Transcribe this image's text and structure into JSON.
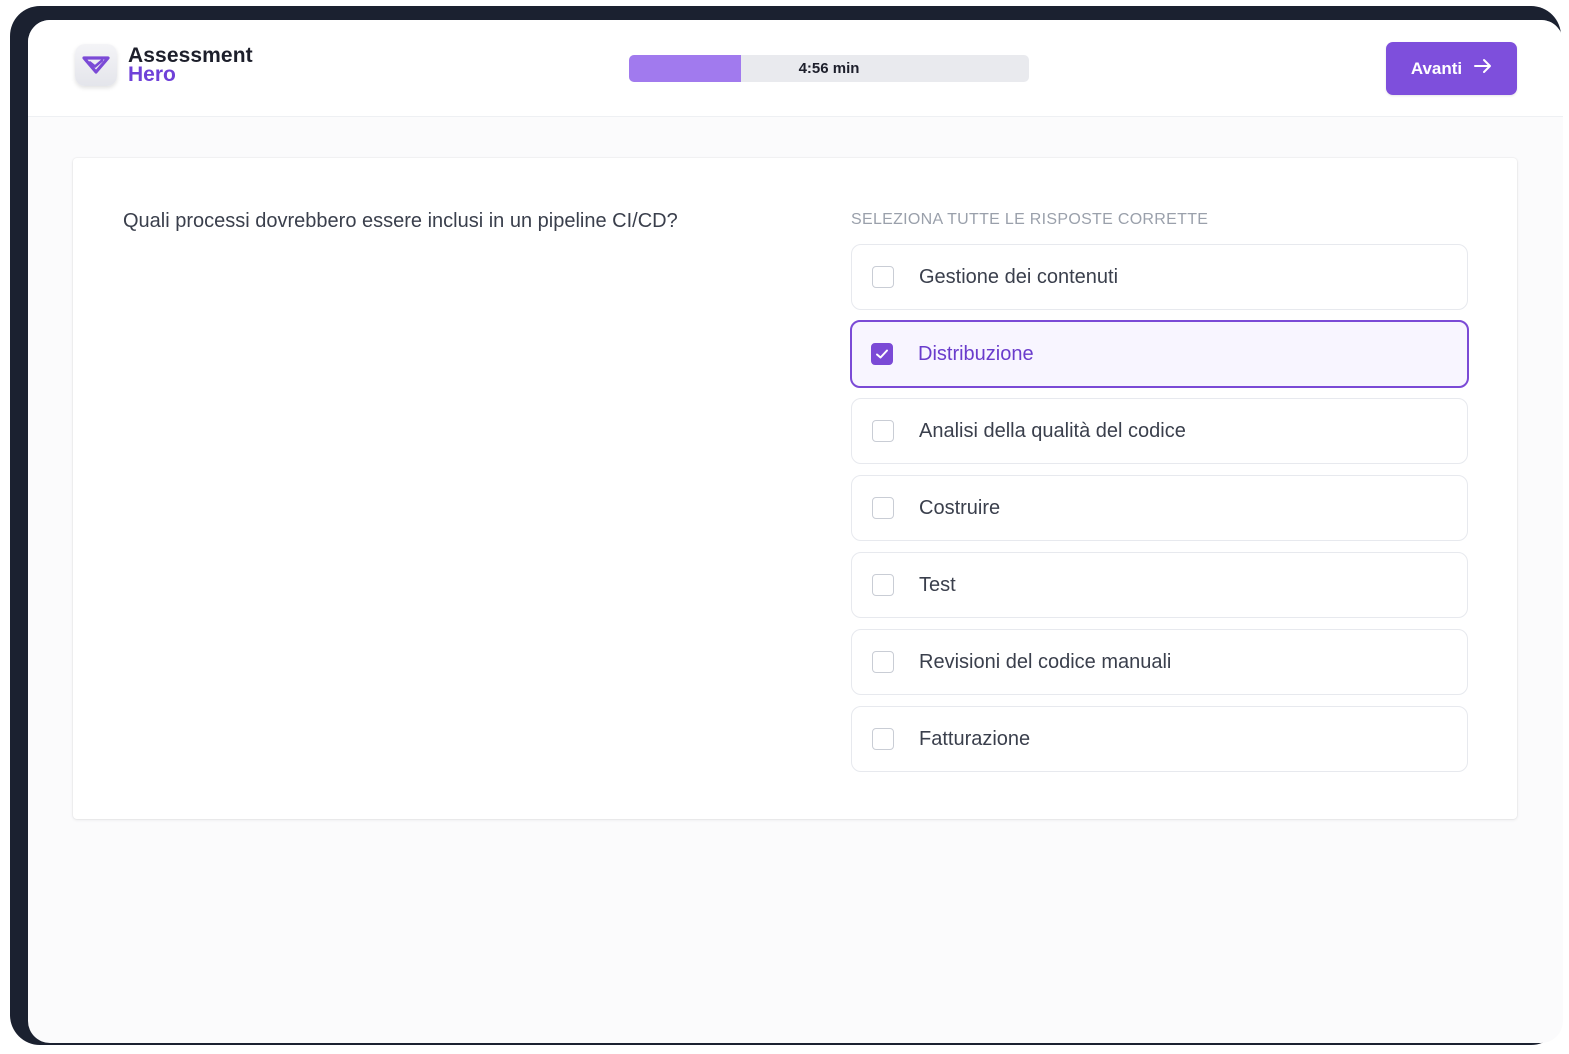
{
  "brand": {
    "name_line1": "Assessment",
    "name_line2": "Hero",
    "accent_color": "#7e4fdc"
  },
  "timer": {
    "label": "4:56 min",
    "progress": 0.28
  },
  "next_button": {
    "label": "Avanti",
    "icon": "arrow-right-icon"
  },
  "question": {
    "text": "Quali processi dovrebbero essere inclusi in un pipeline CI/CD?",
    "instruction": "SELEZIONA TUTTE LE RISPOSTE CORRETTE",
    "options": [
      {
        "label": "Gestione dei contenuti",
        "checked": false
      },
      {
        "label": "Distribuzione",
        "checked": true
      },
      {
        "label": "Analisi della qualità del codice",
        "checked": false
      },
      {
        "label": "Costruire",
        "checked": false
      },
      {
        "label": "Test",
        "checked": false
      },
      {
        "label": "Revisioni del codice manuali",
        "checked": false
      },
      {
        "label": "Fatturazione",
        "checked": false
      }
    ]
  }
}
